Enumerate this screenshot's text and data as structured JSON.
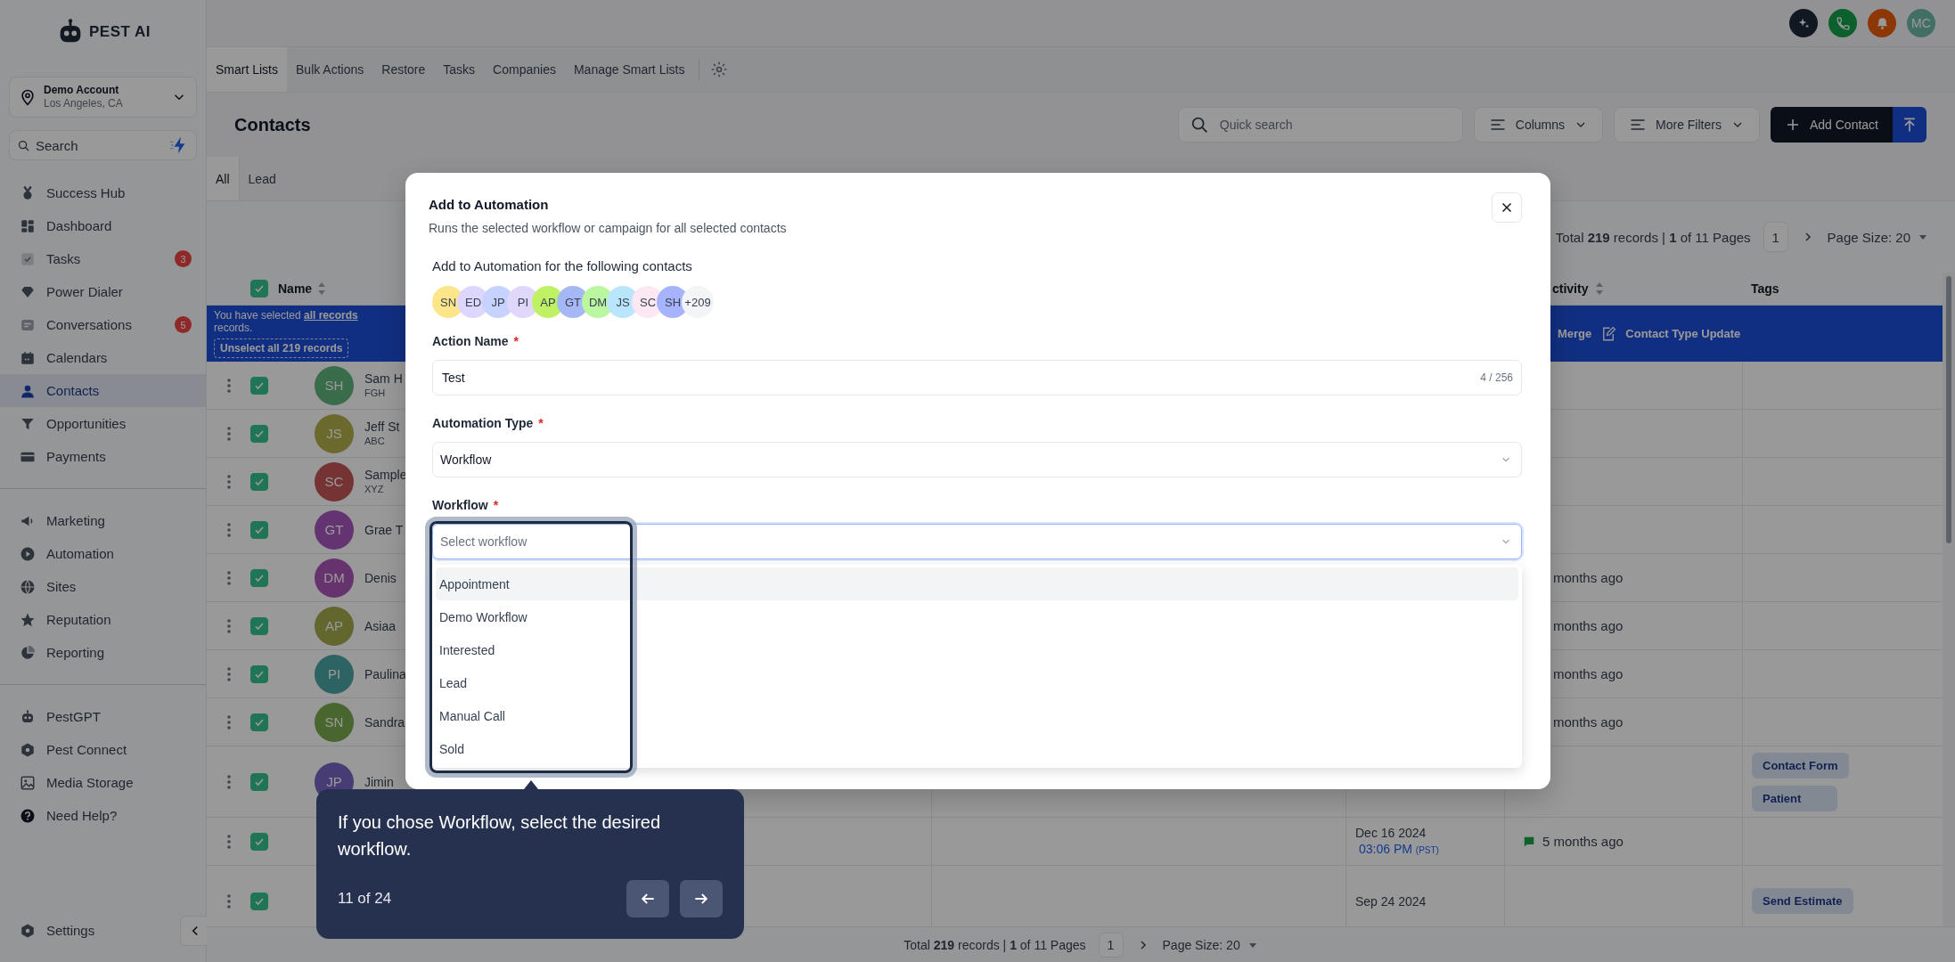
{
  "sidebar": {
    "logo": "PEST AI",
    "account": {
      "name": "Demo Account",
      "location": "Los Angeles, CA"
    },
    "search": {
      "placeholder": "Search"
    },
    "groups": [
      [
        {
          "label": "Success Hub",
          "selected": false
        },
        {
          "label": "Dashboard",
          "selected": false
        },
        {
          "label": "Tasks",
          "selected": false,
          "badge": "3"
        },
        {
          "label": "Power Dialer",
          "selected": false
        },
        {
          "label": "Conversations",
          "selected": false,
          "badge": "5"
        },
        {
          "label": "Calendars",
          "selected": false
        },
        {
          "label": "Contacts",
          "selected": true
        },
        {
          "label": "Opportunities",
          "selected": false
        },
        {
          "label": "Payments",
          "selected": false
        }
      ],
      [
        {
          "label": "Marketing",
          "selected": false
        },
        {
          "label": "Automation",
          "selected": false
        },
        {
          "label": "Sites",
          "selected": false
        },
        {
          "label": "Reputation",
          "selected": false
        },
        {
          "label": "Reporting",
          "selected": false
        }
      ],
      [
        {
          "label": "PestGPT",
          "selected": false
        },
        {
          "label": "Pest Connect",
          "selected": false
        },
        {
          "label": "Media Storage",
          "selected": false
        },
        {
          "label": "Need Help?",
          "selected": false
        }
      ]
    ],
    "settings": "Settings"
  },
  "header": {
    "buttons": [
      {
        "color": "#121821"
      },
      {
        "color": "#0c602d"
      },
      {
        "color": "#8d3606"
      },
      {
        "color": "#426f63",
        "initials": "MC"
      }
    ]
  },
  "tabs": [
    {
      "label": "Smart Lists",
      "selected": true
    },
    {
      "label": "Bulk Actions",
      "selected": false
    },
    {
      "label": "Restore",
      "selected": false
    },
    {
      "label": "Tasks",
      "selected": false
    },
    {
      "label": "Companies",
      "selected": false
    },
    {
      "label": "Manage Smart Lists",
      "selected": false
    }
  ],
  "page": {
    "title": "Contacts",
    "search": {
      "placeholder": "Quick search"
    },
    "columns_button": "Columns",
    "filters_button": "More Filters",
    "add_button": "Add Contact"
  },
  "list_tabs": [
    {
      "label": "All",
      "selected": true
    },
    {
      "label": "Lead",
      "selected": false
    }
  ],
  "top_pagination": {
    "summary": "Total **219** records | **1** of 11 Pages",
    "page": "1",
    "page_size": "Page Size: 20"
  },
  "table": {
    "checked_all": true,
    "headers": {
      "name": "Name",
      "activity": "ctivity",
      "tags": "Tags"
    },
    "selection": {
      "before": "You have selected ",
      "link": "all records",
      "after": " records."
    },
    "unselect": "Unselect all 219 records",
    "bulk_actions": [
      "Merge",
      "Contact Type Update"
    ],
    "rows": [
      {
        "checked": true,
        "initials": "SH",
        "color": "#396c4b",
        "name": "Sam H",
        "company": "FGH"
      },
      {
        "checked": true,
        "initials": "JS",
        "color": "#6c692d",
        "name": "Jeff St",
        "company": "ABC"
      },
      {
        "checked": true,
        "initials": "SC",
        "color": "#753333",
        "name": "Sample",
        "company": "XYZ"
      },
      {
        "checked": true,
        "initials": "GT",
        "color": "#633372",
        "name": "Grae T"
      },
      {
        "checked": true,
        "initials": "DM",
        "color": "#66336f",
        "name": "Denis",
        "activity": {
          "text": "months ago",
          "icon": false
        }
      },
      {
        "checked": true,
        "initials": "AP",
        "color": "#63662d",
        "name": "Asiaa",
        "activity": {
          "text": "months ago",
          "icon": false
        }
      },
      {
        "checked": true,
        "initials": "PI",
        "color": "#2d6363",
        "name": "Paulina",
        "activity": {
          "text": "months ago",
          "icon": false
        }
      },
      {
        "checked": true,
        "initials": "SN",
        "color": "#48662d",
        "name": "Sandra",
        "activity": {
          "text": "months ago",
          "icon": false
        }
      },
      {
        "checked": true,
        "initials": "JP",
        "color": "#483c75",
        "name": "Jimin",
        "tags": [
          "Contact Form",
          "Patient"
        ]
      },
      {
        "checked": true,
        "date": "Dec 16 2024",
        "time": "03:06 PM",
        "zone": "(PST)",
        "activity": {
          "text": "5 months ago",
          "icon": true
        }
      },
      {
        "checked": true,
        "date": "Sep 24 2024",
        "tags": [
          "Send Estimate"
        ]
      }
    ]
  },
  "bottom_pagination": {
    "summary": "Total **219** records | **1** of 11 Pages",
    "page": "1",
    "page_size": "Page Size: 20"
  },
  "modal": {
    "title": "Add to Automation",
    "subtitle": "Runs the selected workflow or campaign for all selected contacts",
    "contacts_label": "Add to Automation for the following contacts",
    "avatars": [
      {
        "initials": "SN",
        "color": "#fde68a"
      },
      {
        "initials": "ED",
        "color": "#ddd6fe"
      },
      {
        "initials": "JP",
        "color": "#c7d2fe"
      },
      {
        "initials": "PI",
        "color": "#e0d7fb"
      },
      {
        "initials": "AP",
        "color": "#bef264"
      },
      {
        "initials": "GT",
        "color": "#a5b8f5"
      },
      {
        "initials": "DM",
        "color": "#bbf7a0"
      },
      {
        "initials": "JS",
        "color": "#bae6fd"
      },
      {
        "initials": "SC",
        "color": "#fce7f3"
      },
      {
        "initials": "SH",
        "color": "#a5b4fc"
      }
    ],
    "more": "+209",
    "fields": [
      {
        "kind": "text",
        "label": "Action Name",
        "mark": "*",
        "value": "Test",
        "counter": "4 / 256",
        "focused": false
      },
      {
        "kind": "select",
        "label": "Automation Type",
        "mark": "*",
        "value": "Workflow",
        "focused": false
      },
      {
        "kind": "select",
        "label": "Workflow",
        "mark": "*",
        "placeholder": "Select workflow",
        "focused": true
      }
    ],
    "options": [
      {
        "label": "Appointment",
        "selected": true
      },
      {
        "label": "Demo Workflow",
        "selected": false
      },
      {
        "label": "Interested",
        "selected": false
      },
      {
        "label": "Lead",
        "selected": false
      },
      {
        "label": "Manual Call",
        "selected": false
      },
      {
        "label": "Sold",
        "selected": false
      }
    ]
  },
  "tooltip": {
    "text": "If you chose Workflow, select the desired workflow.",
    "step": "11 of 24"
  }
}
